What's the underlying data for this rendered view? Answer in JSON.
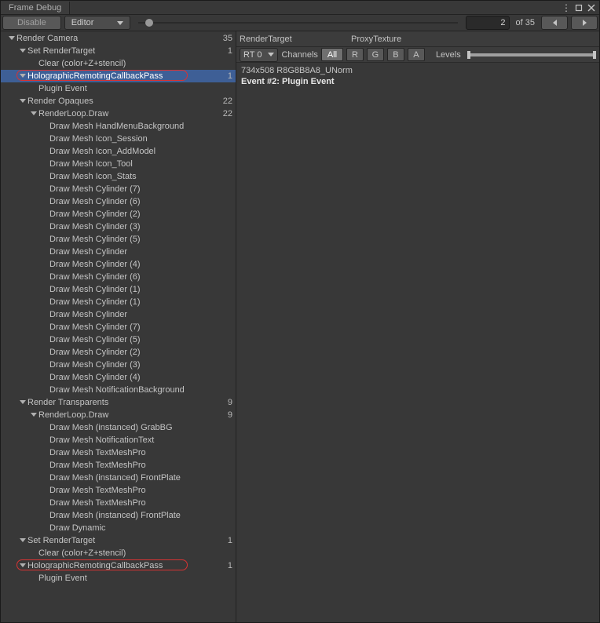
{
  "window": {
    "title": "Frame Debug"
  },
  "toolbar": {
    "disable": "Disable",
    "scope": "Editor",
    "current": "2",
    "of": "of 35"
  },
  "tree": [
    {
      "indent": 0,
      "fold": true,
      "label": "Render Camera",
      "count": "35"
    },
    {
      "indent": 1,
      "fold": true,
      "label": "Set RenderTarget",
      "count": "1"
    },
    {
      "indent": 2,
      "fold": false,
      "label": "Clear (color+Z+stencil)"
    },
    {
      "indent": 1,
      "fold": true,
      "label": "HolographicRemotingCallbackPass",
      "count": "1",
      "selected": true,
      "circled": true
    },
    {
      "indent": 2,
      "fold": false,
      "label": "Plugin Event"
    },
    {
      "indent": 1,
      "fold": true,
      "label": "Render Opaques",
      "count": "22"
    },
    {
      "indent": 2,
      "fold": true,
      "label": "RenderLoop.Draw",
      "count": "22"
    },
    {
      "indent": 3,
      "fold": false,
      "label": "Draw Mesh HandMenuBackground"
    },
    {
      "indent": 3,
      "fold": false,
      "label": "Draw Mesh Icon_Session"
    },
    {
      "indent": 3,
      "fold": false,
      "label": "Draw Mesh Icon_AddModel"
    },
    {
      "indent": 3,
      "fold": false,
      "label": "Draw Mesh Icon_Tool"
    },
    {
      "indent": 3,
      "fold": false,
      "label": "Draw Mesh Icon_Stats"
    },
    {
      "indent": 3,
      "fold": false,
      "label": "Draw Mesh Cylinder (7)"
    },
    {
      "indent": 3,
      "fold": false,
      "label": "Draw Mesh Cylinder (6)"
    },
    {
      "indent": 3,
      "fold": false,
      "label": "Draw Mesh Cylinder (2)"
    },
    {
      "indent": 3,
      "fold": false,
      "label": "Draw Mesh Cylinder (3)"
    },
    {
      "indent": 3,
      "fold": false,
      "label": "Draw Mesh Cylinder (5)"
    },
    {
      "indent": 3,
      "fold": false,
      "label": "Draw Mesh Cylinder"
    },
    {
      "indent": 3,
      "fold": false,
      "label": "Draw Mesh Cylinder (4)"
    },
    {
      "indent": 3,
      "fold": false,
      "label": "Draw Mesh Cylinder (6)"
    },
    {
      "indent": 3,
      "fold": false,
      "label": "Draw Mesh Cylinder (1)"
    },
    {
      "indent": 3,
      "fold": false,
      "label": "Draw Mesh Cylinder (1)"
    },
    {
      "indent": 3,
      "fold": false,
      "label": "Draw Mesh Cylinder"
    },
    {
      "indent": 3,
      "fold": false,
      "label": "Draw Mesh Cylinder (7)"
    },
    {
      "indent": 3,
      "fold": false,
      "label": "Draw Mesh Cylinder (5)"
    },
    {
      "indent": 3,
      "fold": false,
      "label": "Draw Mesh Cylinder (2)"
    },
    {
      "indent": 3,
      "fold": false,
      "label": "Draw Mesh Cylinder (3)"
    },
    {
      "indent": 3,
      "fold": false,
      "label": "Draw Mesh Cylinder (4)"
    },
    {
      "indent": 3,
      "fold": false,
      "label": "Draw Mesh NotificationBackground"
    },
    {
      "indent": 1,
      "fold": true,
      "label": "Render Transparents",
      "count": "9"
    },
    {
      "indent": 2,
      "fold": true,
      "label": "RenderLoop.Draw",
      "count": "9"
    },
    {
      "indent": 3,
      "fold": false,
      "label": "Draw Mesh (instanced) GrabBG"
    },
    {
      "indent": 3,
      "fold": false,
      "label": "Draw Mesh NotificationText"
    },
    {
      "indent": 3,
      "fold": false,
      "label": "Draw Mesh TextMeshPro"
    },
    {
      "indent": 3,
      "fold": false,
      "label": "Draw Mesh TextMeshPro"
    },
    {
      "indent": 3,
      "fold": false,
      "label": "Draw Mesh (instanced) FrontPlate"
    },
    {
      "indent": 3,
      "fold": false,
      "label": "Draw Mesh TextMeshPro"
    },
    {
      "indent": 3,
      "fold": false,
      "label": "Draw Mesh TextMeshPro"
    },
    {
      "indent": 3,
      "fold": false,
      "label": "Draw Mesh (instanced) FrontPlate"
    },
    {
      "indent": 3,
      "fold": false,
      "label": "Draw Dynamic"
    },
    {
      "indent": 1,
      "fold": true,
      "label": "Set RenderTarget",
      "count": "1"
    },
    {
      "indent": 2,
      "fold": false,
      "label": "Clear (color+Z+stencil)"
    },
    {
      "indent": 1,
      "fold": true,
      "label": "HolographicRemotingCallbackPass",
      "count": "1",
      "circled": true
    },
    {
      "indent": 2,
      "fold": false,
      "label": "Plugin Event"
    }
  ],
  "right": {
    "renderTargetLabel": "RenderTarget",
    "renderTargetValue": "ProxyTexture",
    "rt": "RT 0",
    "channels": "Channels",
    "chanAll": "All",
    "chanR": "R",
    "chanG": "G",
    "chanB": "B",
    "chanA": "A",
    "levels": "Levels",
    "size": "734x508 R8G8B8A8_UNorm",
    "event": "Event #2: Plugin Event"
  }
}
